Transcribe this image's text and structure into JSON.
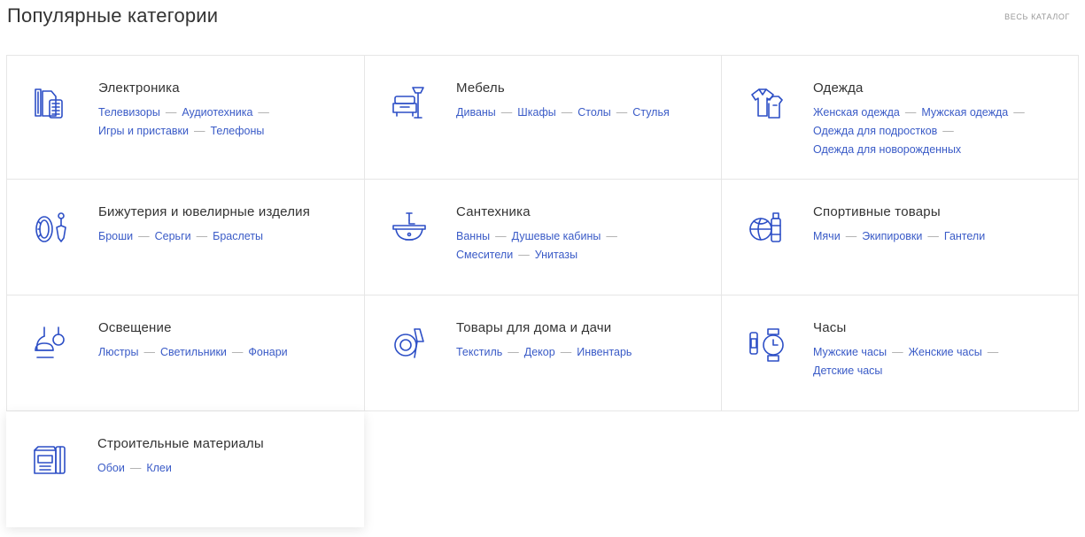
{
  "header": {
    "title": "Популярные категории",
    "catalog_link": "ВЕСЬ КАТАЛОГ"
  },
  "categories": [
    {
      "name": "Электроника",
      "icon": "electronics-icon",
      "links": [
        "Телевизоры",
        "Аудиотехника",
        "Игры и приставки",
        "Телефоны"
      ]
    },
    {
      "name": "Мебель",
      "icon": "furniture-icon",
      "links": [
        "Диваны",
        "Шкафы",
        "Столы",
        "Стулья"
      ]
    },
    {
      "name": "Одежда",
      "icon": "clothing-icon",
      "links": [
        "Женская одежда",
        "Мужская одежда",
        "Одежда для подростков",
        "Одежда для новорожденных"
      ]
    },
    {
      "name": "Бижутерия и ювелирные изделия",
      "icon": "jewelry-icon",
      "links": [
        "Броши",
        "Серьги",
        "Браслеты"
      ]
    },
    {
      "name": "Сантехника",
      "icon": "plumbing-icon",
      "links": [
        "Ванны",
        "Душевые кабины",
        "Смесители",
        "Унитазы"
      ]
    },
    {
      "name": "Спортивные товары",
      "icon": "sports-icon",
      "links": [
        "Мячи",
        "Экипировки",
        "Гантели"
      ]
    },
    {
      "name": "Освещение",
      "icon": "lighting-icon",
      "links": [
        "Люстры",
        "Светильники",
        "Фонари"
      ]
    },
    {
      "name": "Товары для дома и дачи",
      "icon": "home-garden-icon",
      "links": [
        "Текстиль",
        "Декор",
        "Инвентарь"
      ]
    },
    {
      "name": "Часы",
      "icon": "watches-icon",
      "links": [
        "Мужские часы",
        "Женские часы",
        "Детские часы"
      ]
    },
    {
      "name": "Строительные материалы",
      "icon": "building-materials-icon",
      "links": [
        "Обои",
        "Клеи"
      ]
    }
  ],
  "colors": {
    "accent": "#2d4fc6",
    "link": "#3a5bc7",
    "border": "#e6e6e6"
  }
}
